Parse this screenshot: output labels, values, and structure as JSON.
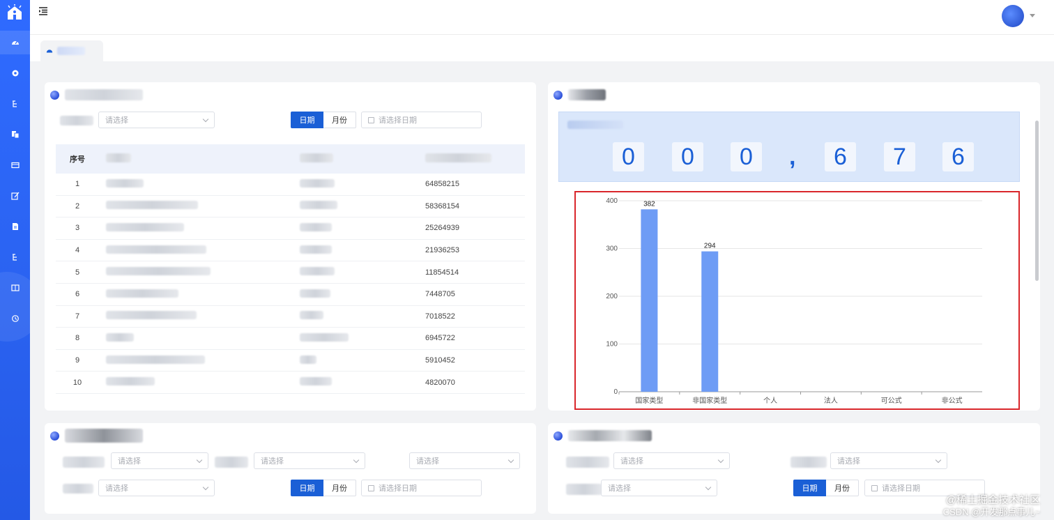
{
  "header": {
    "menu_icon": "hamburger-menu-icon",
    "avatar_icon": "avatar"
  },
  "sidebar": {
    "logo": "house-logo-icon",
    "items": [
      {
        "icon": "dashboard-icon"
      },
      {
        "icon": "gear-icon"
      },
      {
        "icon": "tree-icon"
      },
      {
        "icon": "copy-icon"
      },
      {
        "icon": "card-icon"
      },
      {
        "icon": "edit-icon"
      },
      {
        "icon": "document-icon"
      },
      {
        "icon": "tree-icon"
      },
      {
        "icon": "columns-icon"
      },
      {
        "icon": "history-icon"
      }
    ]
  },
  "tab": {
    "icon": "dashboard-icon"
  },
  "panel1": {
    "select_placeholder": "请选择",
    "seg_day": "日期",
    "seg_month": "月份",
    "date_placeholder": "请选择日期",
    "table": {
      "header_index": "序号",
      "rows": [
        {
          "idx": "1",
          "value": "64858215"
        },
        {
          "idx": "2",
          "value": "58368154"
        },
        {
          "idx": "3",
          "value": "25264939"
        },
        {
          "idx": "4",
          "value": "21936253"
        },
        {
          "idx": "5",
          "value": "11854514"
        },
        {
          "idx": "6",
          "value": "7448705"
        },
        {
          "idx": "7",
          "value": "7018522"
        },
        {
          "idx": "8",
          "value": "6945722"
        },
        {
          "idx": "9",
          "value": "5910452"
        },
        {
          "idx": "10",
          "value": "4820070"
        }
      ]
    }
  },
  "panel2": {
    "counter_digits": [
      "0",
      "0",
      "0",
      ",",
      "6",
      "7",
      "6"
    ]
  },
  "chart_data": {
    "type": "bar",
    "categories": [
      "国家类型",
      "非国家类型",
      "个人",
      "法人",
      "可公式",
      "非公式"
    ],
    "values": [
      382,
      294,
      0,
      0,
      0,
      0
    ],
    "data_labels": [
      "382",
      "294",
      "",
      "",
      "",
      ""
    ],
    "yticks": [
      "0",
      "100",
      "200",
      "300",
      "400"
    ],
    "ylim": [
      0,
      400
    ],
    "grid": true,
    "bar_color": "#6e9cf5"
  },
  "panel3": {
    "select_placeholder": "请选择",
    "seg_day": "日期",
    "seg_month": "月份",
    "date_placeholder": "请选择日期"
  },
  "panel4": {
    "select_placeholder": "请选择",
    "seg_day": "日期",
    "seg_month": "月份",
    "date_placeholder": "请选择日期"
  },
  "watermark": {
    "line1": "@稀土掘金技术社区",
    "line2": "CSDN @开发那点事儿~"
  },
  "colors": {
    "primary": "#1a5fd6",
    "sidebar": "#2f6bff",
    "alert_border": "#d9262b"
  }
}
